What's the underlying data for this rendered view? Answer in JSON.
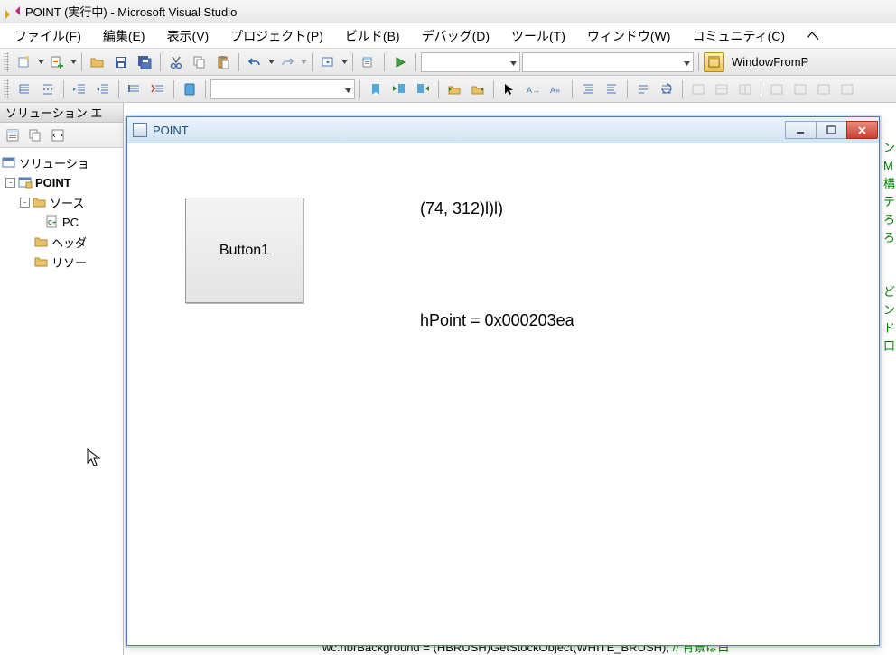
{
  "title": "POINT (実行中) - Microsoft Visual Studio",
  "menu": {
    "file": "ファイル(F)",
    "edit": "編集(E)",
    "view": "表示(V)",
    "project": "プロジェクト(P)",
    "build": "ビルド(B)",
    "debug": "デバッグ(D)",
    "tools": "ツール(T)",
    "window": "ウィンドウ(W)",
    "community": "コミュニティ(C)",
    "help": "ヘ"
  },
  "toolbar": {
    "windowFrom": "WindowFromP"
  },
  "sidebar": {
    "title": "ソリューション エ",
    "solution": "ソリューショ",
    "project": "POINT",
    "source": "ソース",
    "cpp_prefix": "PC",
    "headers": "ヘッダ",
    "resources": "リソー"
  },
  "app": {
    "title": "POINT",
    "button1": "Button1",
    "coord": "(74, 312)l)l)",
    "hpoint": "hPoint = 0x000203ea"
  },
  "code": {
    "bottom_left": "wc.hbrBackground = (HBRUSH)GetStockObject(WHITE_BRUSH); ",
    "bottom_comment": "// 背景は白"
  }
}
